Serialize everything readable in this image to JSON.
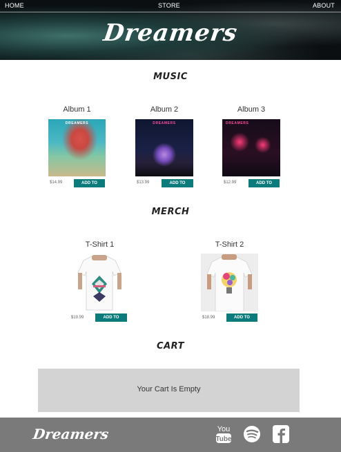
{
  "nav": {
    "home": "HOME",
    "store": "STORE",
    "about": "ABOUT"
  },
  "brand": {
    "name": "Dreamers"
  },
  "sections": {
    "music": "MUSIC",
    "merch": "MERCH",
    "cart": "CART"
  },
  "albums": [
    {
      "title": "Album 1",
      "price": "$14.99",
      "art_text": "DREAMERS",
      "button": "ADD TO"
    },
    {
      "title": "Album 2",
      "price": "$13.99",
      "art_text": "DREAMERS",
      "button": "ADD TO"
    },
    {
      "title": "Album 3",
      "price": "$12.99",
      "art_text": "DREAMERS",
      "button": "ADD TO"
    }
  ],
  "merch": [
    {
      "title": "T-Shirt 1",
      "price": "$19.99",
      "button": "ADD TO"
    },
    {
      "title": "T-Shirt 2",
      "price": "$18.99",
      "button": "ADD TO"
    }
  ],
  "cart": {
    "empty_message": "Your Cart Is Empty"
  },
  "footer": {
    "logo": "Dreamers",
    "social": [
      "youtube-icon",
      "spotify-icon",
      "facebook-icon"
    ]
  },
  "colors": {
    "accent": "#0c7b7c",
    "footer_bg": "#7a7a7a",
    "cart_bg": "#d3d3d3"
  }
}
